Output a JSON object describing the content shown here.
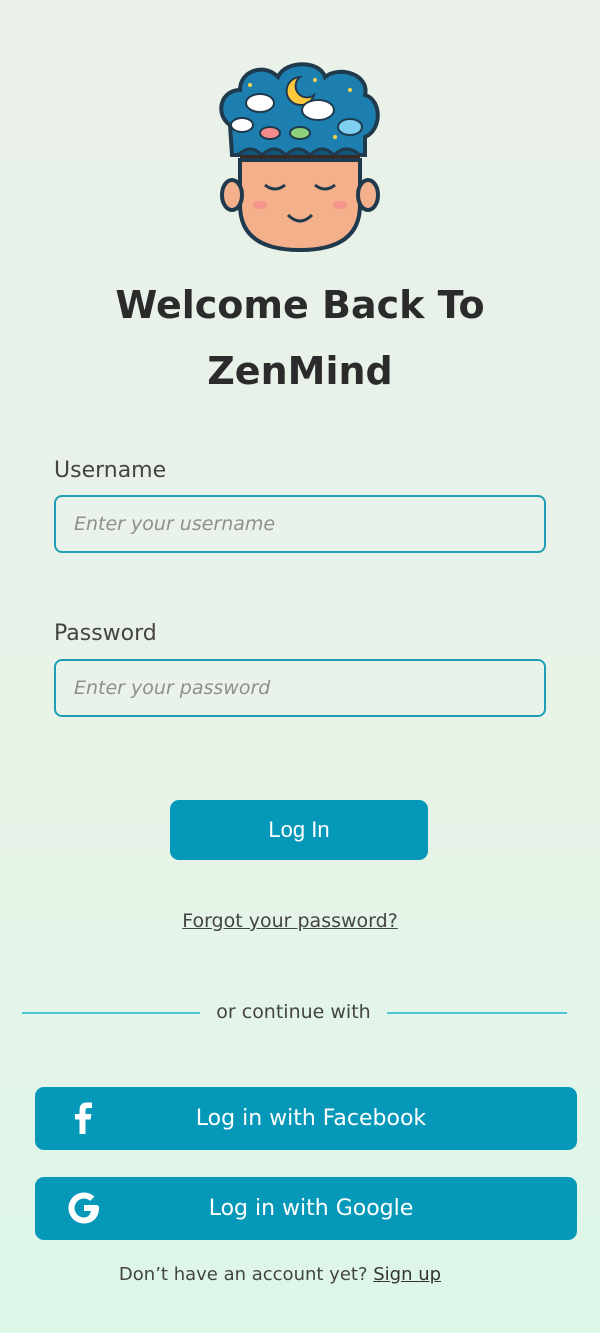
{
  "logo": {
    "icon": "zenmind-head-clouds-icon"
  },
  "title": {
    "line1": "Welcome Back To",
    "line2": "ZenMind"
  },
  "username": {
    "label": "Username",
    "placeholder": "Enter your username",
    "value": ""
  },
  "password": {
    "label": "Password",
    "placeholder": "Enter your password",
    "value": ""
  },
  "login_button": "Log In",
  "forgot_link": "Forgot your password?",
  "divider_text": "or continue with",
  "social": {
    "facebook_label": "Log in with Facebook",
    "facebook_icon": "facebook-icon",
    "google_label": "Log in with  Google",
    "google_icon": "google-icon"
  },
  "signup": {
    "prompt": "Don’t have an account yet?",
    "link": "Sign up"
  },
  "colors": {
    "accent": "#0598b8",
    "field_border": "#1f9fb6",
    "divider": "#4ec5d6"
  }
}
